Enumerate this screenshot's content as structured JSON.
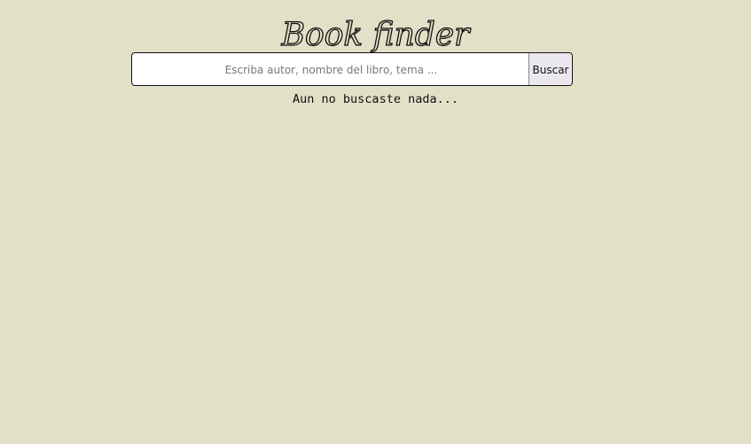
{
  "header": {
    "title": "Book finder"
  },
  "search": {
    "placeholder": "Escriba autor, nombre del libro, tema ...",
    "value": "",
    "button_label": "Buscar"
  },
  "results": {
    "status_text": "Aun no buscaste nada..."
  },
  "colors": {
    "background": "#e3e0c8",
    "input_background": "#ffffff",
    "button_background": "#ebe7ee",
    "text": "#111111"
  }
}
